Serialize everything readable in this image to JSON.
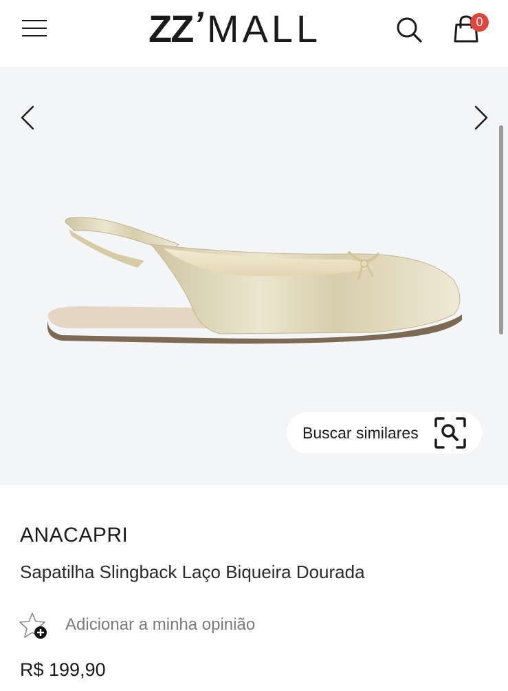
{
  "header": {
    "logo": {
      "zz": "ZZ",
      "apostrophe": "’",
      "mall": "MALL"
    },
    "bag_count": "0",
    "icons": {
      "menu": "hamburger-menu-icon",
      "search": "search-icon",
      "bag": "shopping-bag-icon"
    }
  },
  "gallery": {
    "similar_button_label": "Buscar similares",
    "icons": {
      "prev": "chevron-left-icon",
      "next": "chevron-right-icon",
      "similar": "image-search-icon"
    }
  },
  "product": {
    "brand": "ANACAPRI",
    "title": "Sapatilha Slingback Laço Biqueira Dourada",
    "review_label": "Adicionar a minha opinião",
    "price": "R$ 199,90"
  },
  "colors": {
    "gallery_bg": "#f4f5f7",
    "badge": "#e0453c",
    "text": "#1a1a1a",
    "muted_text": "#7a7a7a",
    "shoe_gold": "#d9cfae"
  }
}
